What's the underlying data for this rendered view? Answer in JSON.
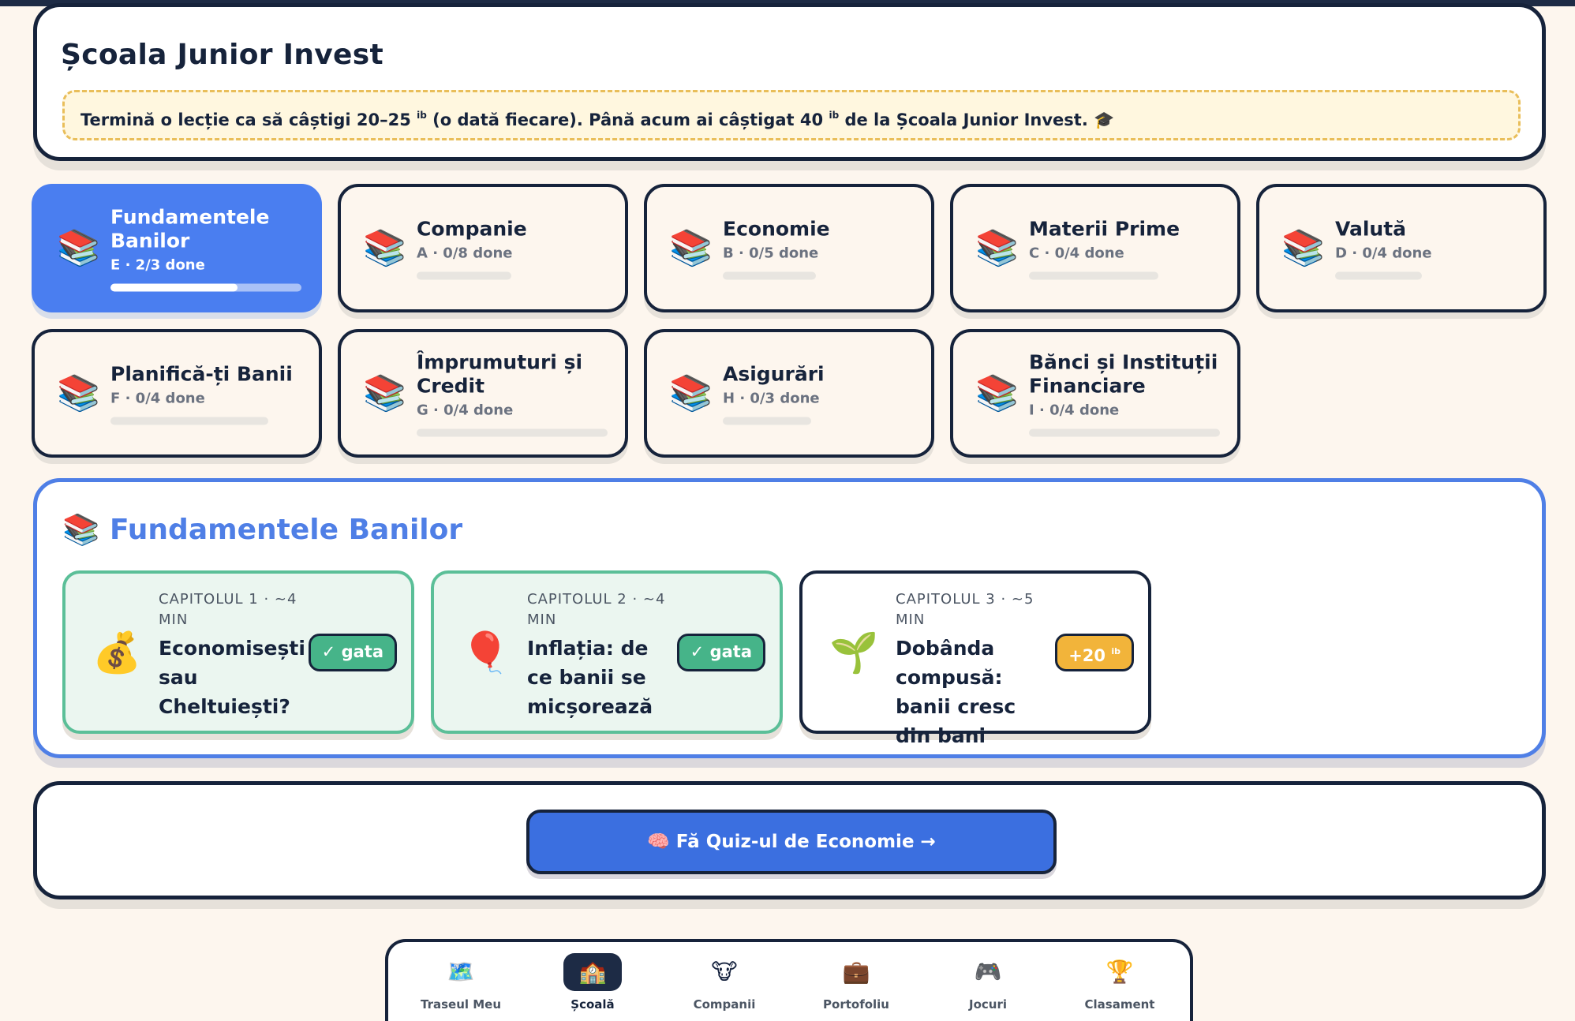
{
  "header": {
    "title": "Școala Junior Invest",
    "banner": {
      "before_range": "Termină o lecție ca să câștigi 20–25 ",
      "unit1": "ib",
      "middle": " (o dată fiecare). Până acum ai câștigat 40 ",
      "unit2": "ib",
      "after": " de la Școala Junior Invest. 🎓"
    }
  },
  "modules": [
    {
      "name": "Fundamentele Banilor",
      "meta": "E · 2/3 done",
      "done": 2,
      "total": 3,
      "icon": "📚",
      "active": true
    },
    {
      "name": "Companie",
      "meta": "A · 0/8 done",
      "done": 0,
      "total": 8,
      "icon": "📚"
    },
    {
      "name": "Economie",
      "meta": "B · 0/5 done",
      "done": 0,
      "total": 5,
      "icon": "📚"
    },
    {
      "name": "Materii Prime",
      "meta": "C · 0/4 done",
      "done": 0,
      "total": 4,
      "icon": "📚"
    },
    {
      "name": "Valută",
      "meta": "D · 0/4 done",
      "done": 0,
      "total": 4,
      "icon": "📚"
    },
    {
      "name": "Planifică-ți Banii",
      "meta": "F · 0/4 done",
      "done": 0,
      "total": 4,
      "icon": "📚"
    },
    {
      "name": "Împrumuturi și Credit",
      "meta": "G · 0/4 done",
      "done": 0,
      "total": 4,
      "icon": "📚"
    },
    {
      "name": "Asigurări",
      "meta": "H · 0/3 done",
      "done": 0,
      "total": 3,
      "icon": "📚"
    },
    {
      "name": "Bănci și Instituții Financiare",
      "meta": "I · 0/4 done",
      "done": 0,
      "total": 4,
      "icon": "📚"
    }
  ],
  "detail": {
    "icon": "📚",
    "title": "Fundamentele Banilor",
    "lessons": [
      {
        "meta": "CAPITOLUL 1 · ~4 MIN",
        "title": "Economisești sau Cheltuiești?",
        "icon": "💰",
        "badge": "✓ gata",
        "done": true
      },
      {
        "meta": "CAPITOLUL 2 · ~4 MIN",
        "title": "Inflația: de ce banii se micșorează",
        "icon": "🎈",
        "badge": "✓ gata",
        "done": true
      },
      {
        "meta": "CAPITOLUL 3 · ~5 MIN",
        "title": "Dobânda compusă: banii cresc din bani",
        "icon": "🌱",
        "badge": "+20",
        "badge_unit": "ib",
        "done": false
      }
    ]
  },
  "quiz": {
    "label": "🧠 Fă Quiz-ul de Economie →"
  },
  "nav": [
    {
      "label": "Traseul Meu",
      "icon": "🗺️"
    },
    {
      "label": "Școală",
      "icon": "🏫",
      "active": true
    },
    {
      "label": "Companii",
      "icon": "🐮"
    },
    {
      "label": "Portofoliu",
      "icon": "💼"
    },
    {
      "label": "Jocuri",
      "icon": "🎮"
    },
    {
      "label": "Clasament",
      "icon": "🏆"
    }
  ],
  "colors": {
    "accent": "#4a7ef0",
    "dark": "#16233b",
    "done_green": "#46b489",
    "reward_gold": "#f2b43a",
    "background": "#fdf6ee"
  }
}
